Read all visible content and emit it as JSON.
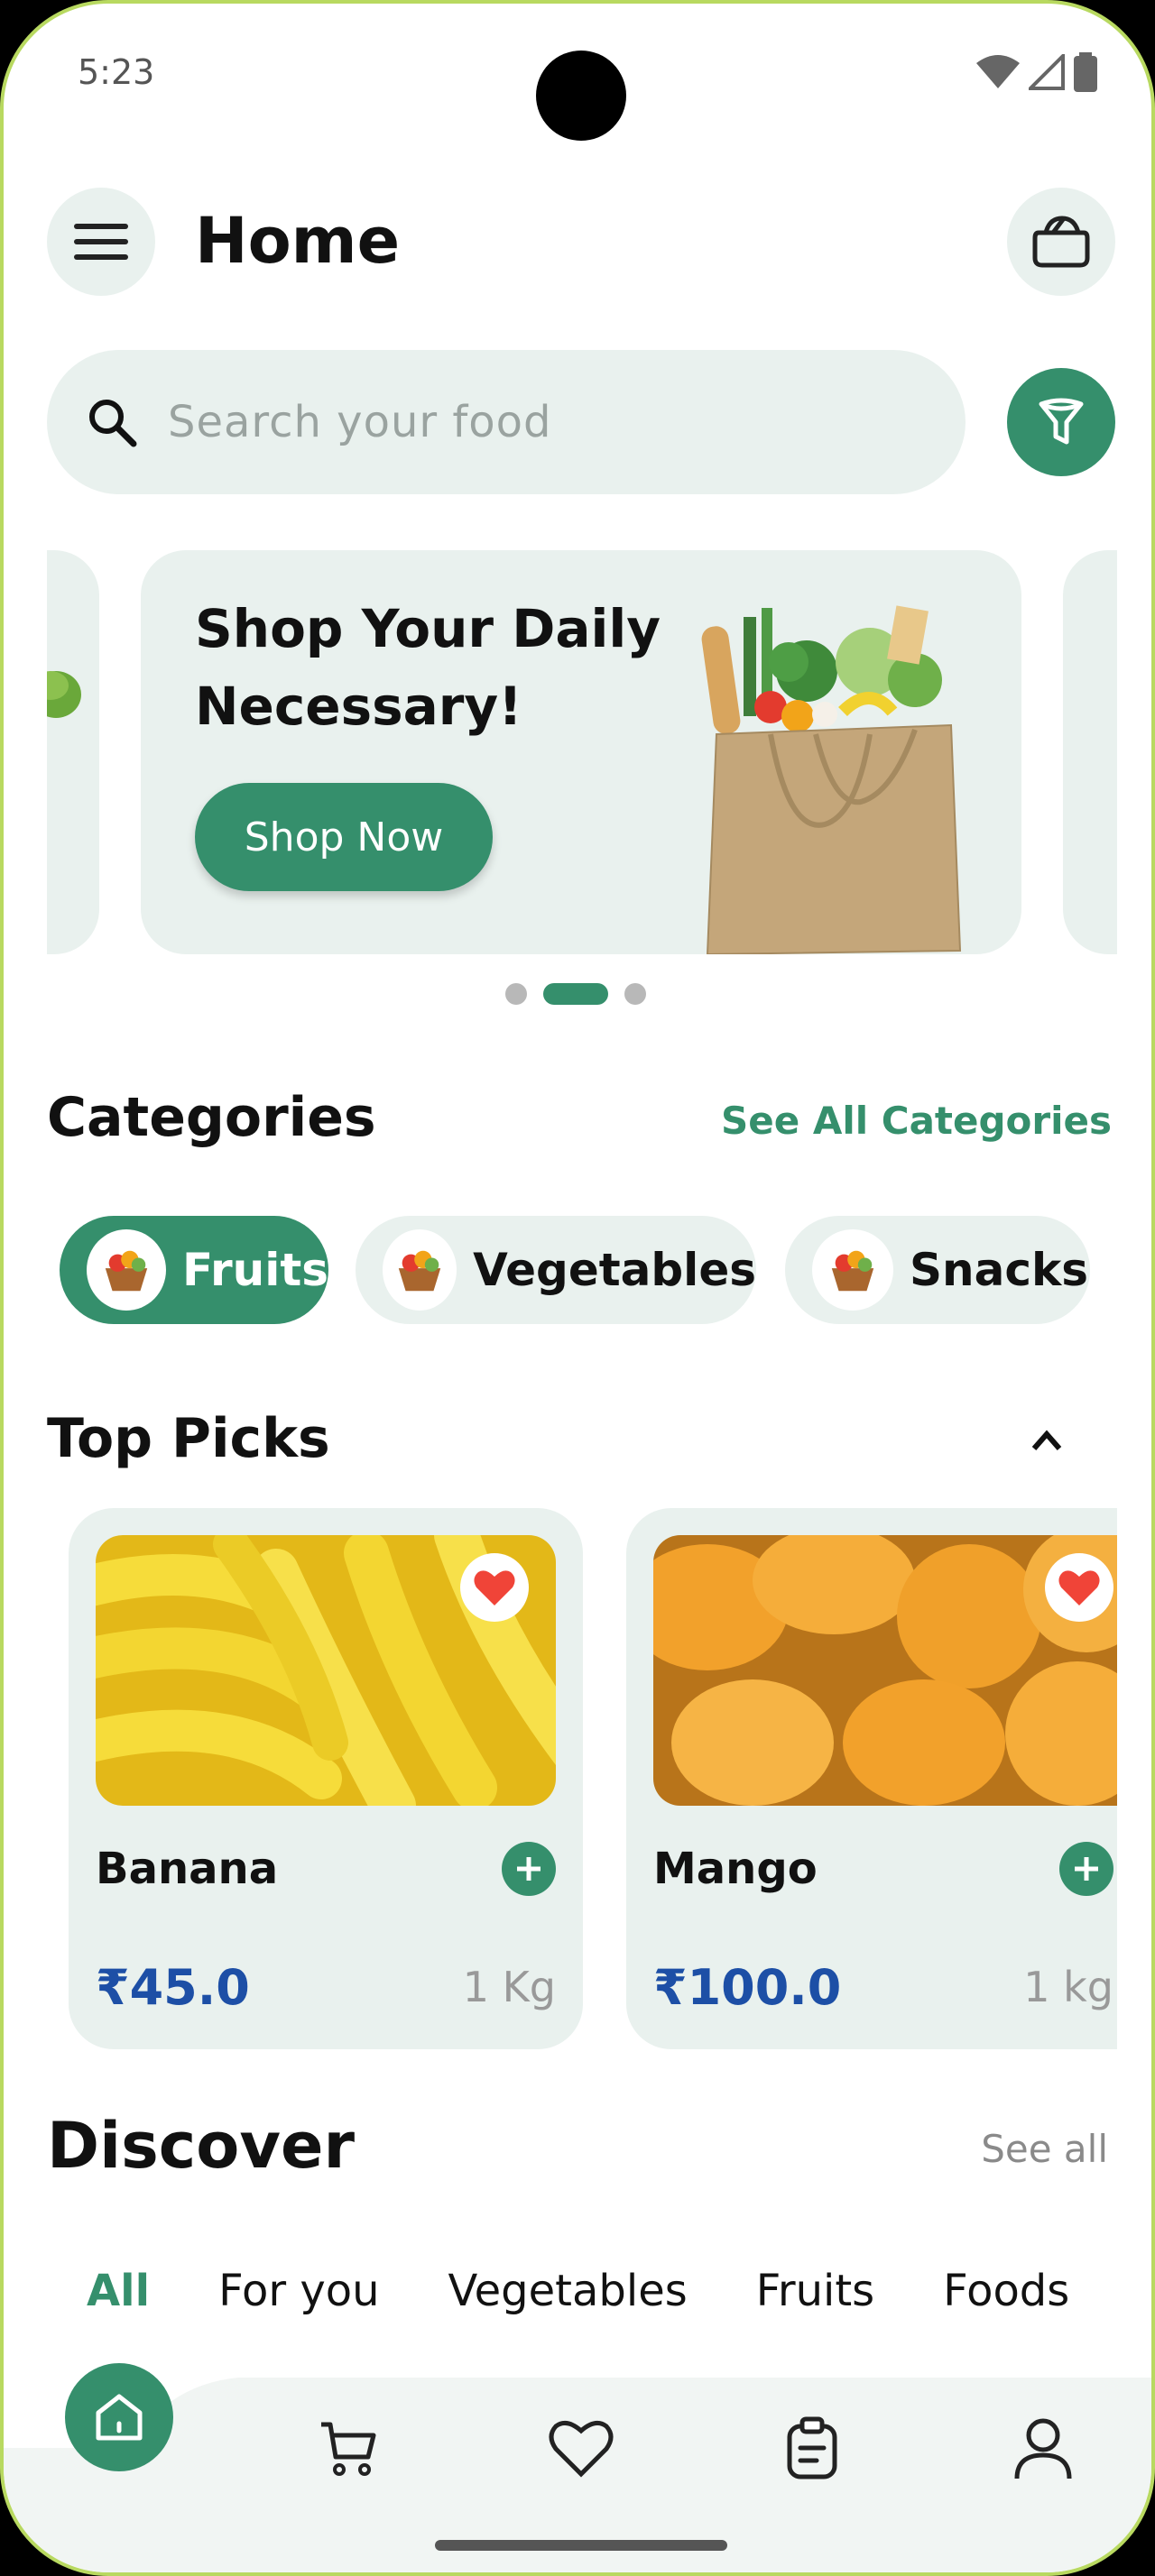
{
  "status_bar": {
    "time": "5:23"
  },
  "header": {
    "title": "Home"
  },
  "search": {
    "placeholder": "Search your food"
  },
  "banner": {
    "title": "Shop Your Daily Necessary!",
    "button_label": "Shop Now",
    "page_count": 3,
    "active_page": 2
  },
  "categories": {
    "title": "Categories",
    "see_all_label": "See All Categories",
    "items": [
      {
        "label": "Fruits",
        "active": true
      },
      {
        "label": "Vegetables",
        "active": false
      },
      {
        "label": "Snacks",
        "active": false
      }
    ]
  },
  "top_picks": {
    "title": "Top Picks",
    "items": [
      {
        "name": "Banana",
        "price": "₹45.0",
        "unit": "1 Kg",
        "favorite": true
      },
      {
        "name": "Mango",
        "price": "₹100.0",
        "unit": "1 kg",
        "favorite": true
      }
    ]
  },
  "discover": {
    "title": "Discover",
    "see_all_label": "See all",
    "tabs": [
      "All",
      "For you",
      "Vegetables",
      "Fruits",
      "Foods"
    ],
    "active_tab": "All"
  },
  "colors": {
    "accent": "#358f6c",
    "surface": "#e9f1ee",
    "price": "#1d4fa6",
    "heart": "#f04438"
  },
  "bottom_nav": [
    "home-icon",
    "cart-icon",
    "heart-icon",
    "orders-icon",
    "profile-icon"
  ]
}
